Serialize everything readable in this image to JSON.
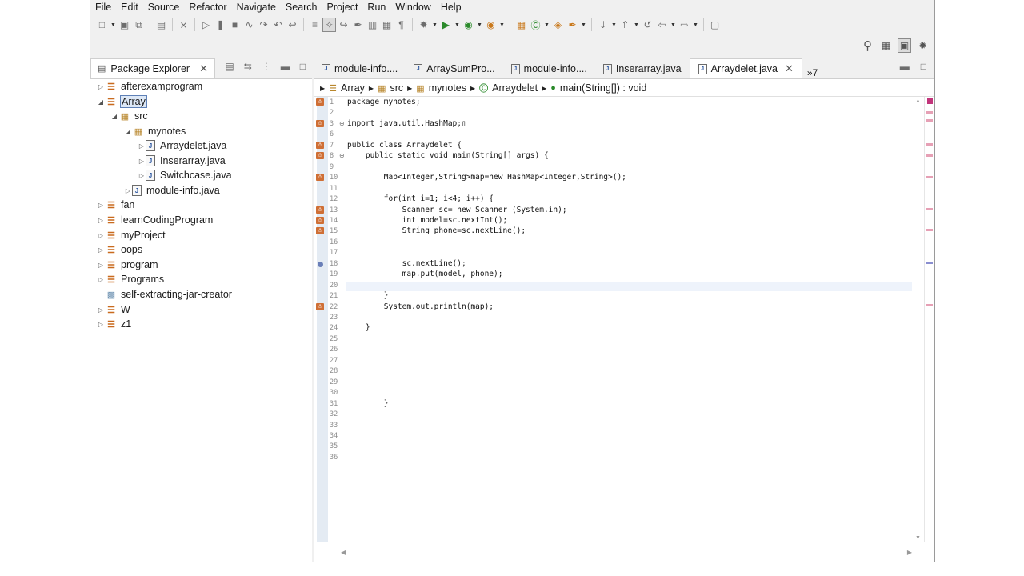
{
  "menu": [
    "File",
    "Edit",
    "Source",
    "Refactor",
    "Navigate",
    "Search",
    "Project",
    "Run",
    "Window",
    "Help"
  ],
  "explorer": {
    "title": "Package Explorer",
    "items": [
      {
        "label": "afterexamprogram",
        "icon": "project-icon",
        "expanded": false
      },
      {
        "label": "Array",
        "icon": "project-icon",
        "expanded": true,
        "selected": true
      },
      {
        "label": "src",
        "icon": "source-folder-icon",
        "expanded": true
      },
      {
        "label": "mynotes",
        "icon": "package-icon",
        "expanded": true
      },
      {
        "label": "Arraydelet.java",
        "icon": "java-file-icon",
        "expanded": false
      },
      {
        "label": "Inserarray.java",
        "icon": "java-file-icon",
        "expanded": false
      },
      {
        "label": "Switchcase.java",
        "icon": "java-file-icon",
        "expanded": false
      },
      {
        "label": "module-info.java",
        "icon": "java-file-icon",
        "expanded": false
      },
      {
        "label": "fan",
        "icon": "project-icon",
        "expanded": false
      },
      {
        "label": "learnCodingProgram",
        "icon": "project-icon",
        "expanded": false
      },
      {
        "label": "myProject",
        "icon": "project-icon",
        "expanded": false
      },
      {
        "label": "oops",
        "icon": "project-icon",
        "expanded": false
      },
      {
        "label": "program",
        "icon": "project-icon",
        "expanded": false
      },
      {
        "label": "Programs",
        "icon": "project-icon",
        "expanded": false
      },
      {
        "label": "self-extracting-jar-creator",
        "icon": "folder-icon",
        "expanded": false
      },
      {
        "label": "W",
        "icon": "project-icon",
        "expanded": false
      },
      {
        "label": "z1",
        "icon": "project-icon",
        "expanded": false
      }
    ]
  },
  "editor": {
    "tabs": [
      {
        "label": "module-info....",
        "active": false
      },
      {
        "label": "ArraySumPro...",
        "active": false
      },
      {
        "label": "module-info....",
        "active": false
      },
      {
        "label": "Inserarray.java",
        "active": false
      },
      {
        "label": "Arraydelet.java",
        "active": true
      }
    ],
    "overflow_label": "»7",
    "breadcrumb": [
      "Array",
      "src",
      "mynotes",
      "Arraydelet",
      "main(String[]) : void"
    ],
    "line_numbers": [
      "1",
      "2",
      "3",
      "6",
      "7",
      "8",
      "9",
      "10",
      "11",
      "12",
      "13",
      "14",
      "15",
      "16",
      "17",
      "18",
      "19",
      "20",
      "21",
      "22",
      "23",
      "24",
      "25",
      "26",
      "27",
      "28",
      "29",
      "30",
      "31",
      "32",
      "33",
      "34",
      "35",
      "36"
    ],
    "code": {
      "1": "package mynotes;",
      "3": "import java.util.HashMap;▯",
      "7": "public class Arraydelet {",
      "8": "    public static void main(String[] args) {",
      "10": "        Map<Integer,String>map=new HashMap<Integer,String>();",
      "12": "        for(int i=1; i<4; i++) {",
      "13": "            Scanner sc= new Scanner (System.in);",
      "14": "            int model=sc.nextInt();",
      "15": "            String phone=sc.nextLine();",
      "18": "            sc.nextLine();",
      "19": "            map.put(model, phone);",
      "21": "        }",
      "22": "        System.out.println(map);",
      "24": "    }",
      "31": "        }"
    }
  }
}
